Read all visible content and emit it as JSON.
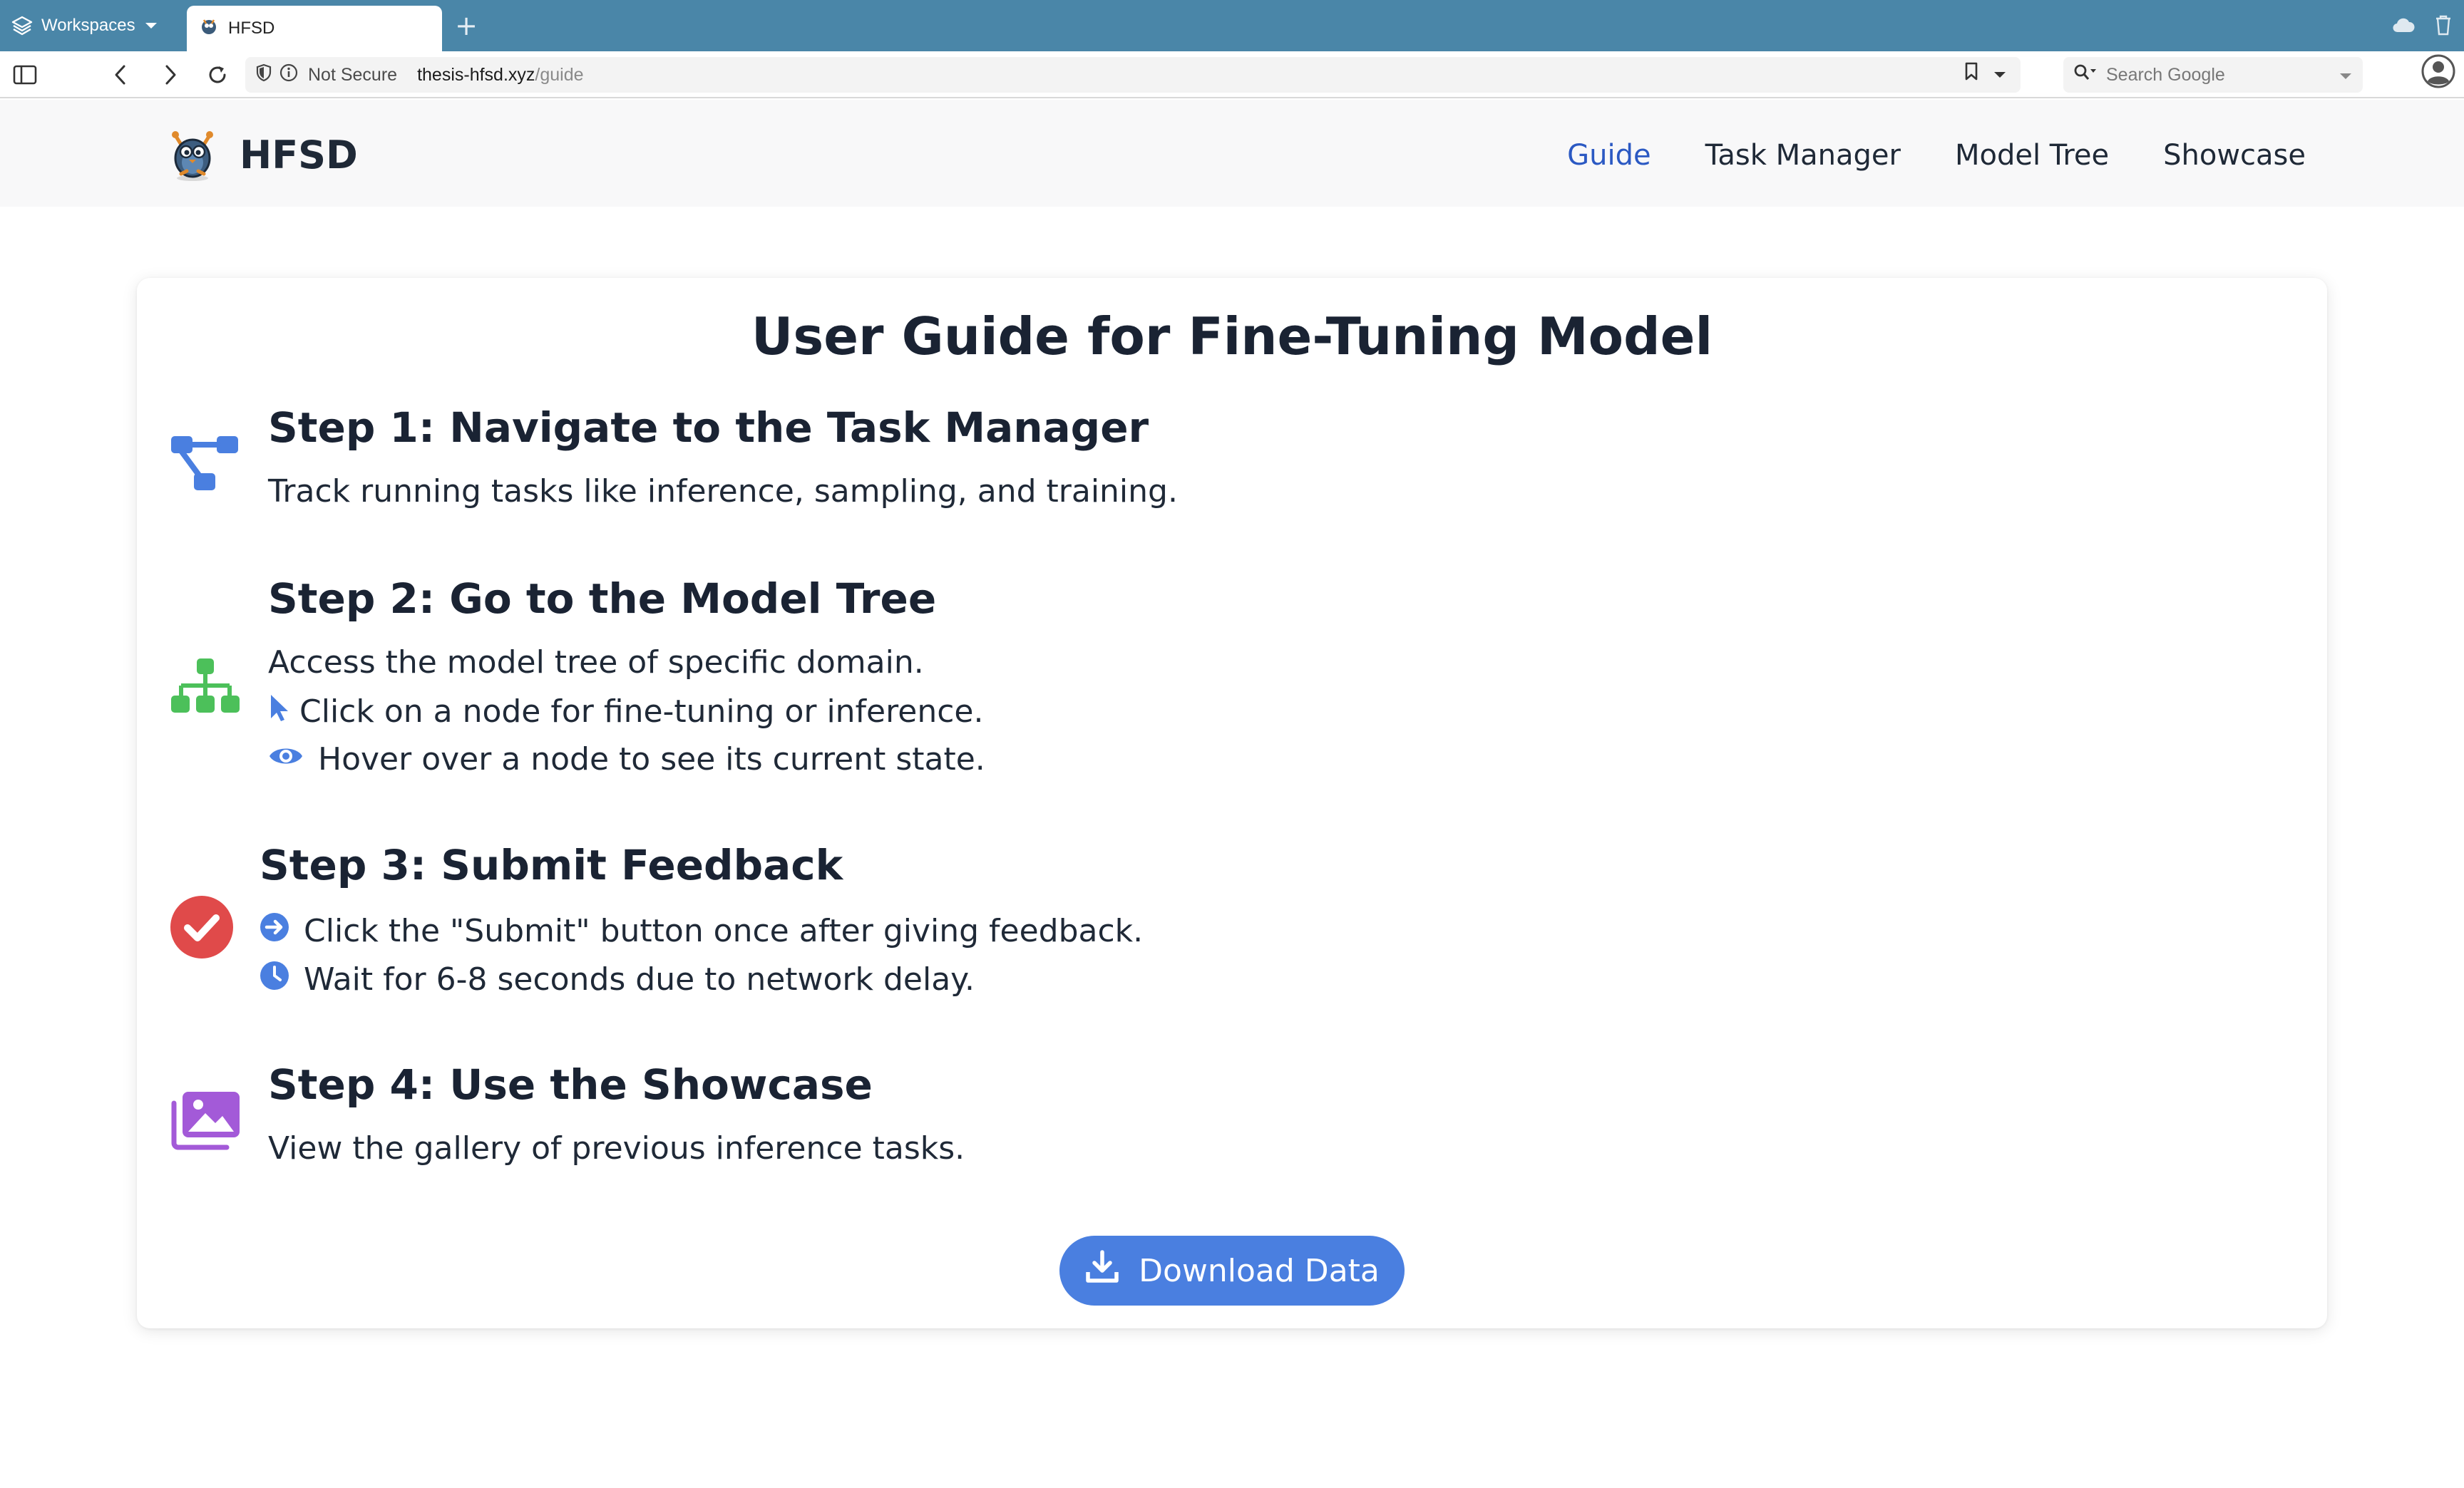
{
  "browser": {
    "workspaces_label": "Workspaces",
    "tab_title": "HFSD",
    "new_tab_symbol": "+",
    "security_label": "Not Secure",
    "url_host": "thesis-hfsd.xyz",
    "url_path": "/guide",
    "search_placeholder": "Search Google",
    "tabstrip_color": "#4a86a8"
  },
  "site": {
    "brand": "HFSD",
    "nav": [
      {
        "label": "Guide",
        "active": true
      },
      {
        "label": "Task Manager",
        "active": false
      },
      {
        "label": "Model Tree",
        "active": false
      },
      {
        "label": "Showcase",
        "active": false
      }
    ],
    "active_color": "#2b59c3"
  },
  "guide": {
    "title": "User Guide for Fine-Tuning Model",
    "steps": [
      {
        "icon": "sitemap-blue-icon",
        "title": "Step 1: Navigate to the Task Manager",
        "lines": [
          {
            "text": "Track running tasks like inference, sampling, and training."
          }
        ]
      },
      {
        "icon": "network-green-icon",
        "title": "Step 2: Go to the Model Tree",
        "lines": [
          {
            "text": "Access the model tree of specific domain."
          },
          {
            "icon": "cursor-pointer-icon",
            "text": "Click on a node for fine-tuning or inference."
          },
          {
            "icon": "eye-icon",
            "text": "Hover over a node to see its current state."
          }
        ]
      },
      {
        "icon": "check-circle-red-icon",
        "title": "Step 3: Submit Feedback",
        "lines": [
          {
            "icon": "arrow-circle-right-icon",
            "text": "Click the \"Submit\" button once after giving feedback."
          },
          {
            "icon": "clock-icon",
            "text": "Wait for 6-8 seconds due to network delay."
          }
        ]
      },
      {
        "icon": "images-purple-icon",
        "title": "Step 4: Use the Showcase",
        "lines": [
          {
            "text": "View the gallery of previous inference tasks."
          }
        ]
      }
    ],
    "download_label": "Download Data",
    "button_color": "#4a7fe0"
  }
}
